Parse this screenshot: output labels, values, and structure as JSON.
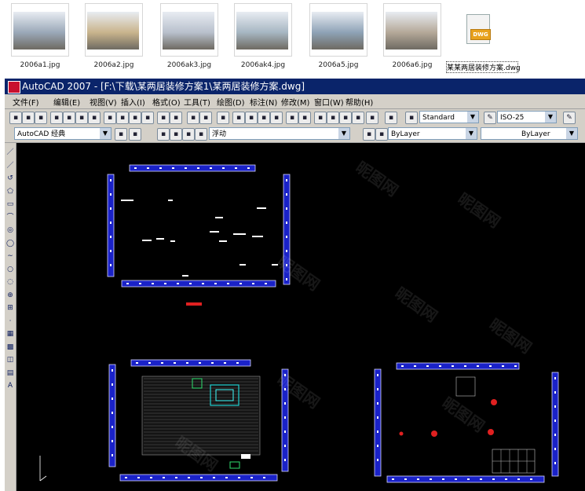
{
  "files": [
    {
      "name": "2006a1.jpg",
      "kind": "image",
      "tone": "#9aa8b8"
    },
    {
      "name": "2006a2.jpg",
      "kind": "image",
      "tone": "#c9b48c"
    },
    {
      "name": "2006ak3.jpg",
      "kind": "image",
      "tone": "#b8c0cc"
    },
    {
      "name": "2006ak4.jpg",
      "kind": "image",
      "tone": "#a6b6c2"
    },
    {
      "name": "2006a5.jpg",
      "kind": "image",
      "tone": "#8ea2b6"
    },
    {
      "name": "2006a6.jpg",
      "kind": "image",
      "tone": "#b4a898"
    },
    {
      "name": "某某两居装修方案.dwg",
      "kind": "dwg",
      "badge": "DWG",
      "selected": true
    }
  ],
  "window": {
    "title": "AutoCAD 2007 - [F:\\下载\\某两居装修方案1\\某两居装修方案.dwg]"
  },
  "menu": [
    "文件(F)",
    "编辑(E)",
    "视图(V)",
    "插入(I)",
    "格式(O)",
    "工具(T)",
    "绘图(D)",
    "标注(N)",
    "修改(M)",
    "窗口(W)",
    "帮助(H)"
  ],
  "toolbar": {
    "text_style": "Standard",
    "dim_style": "ISO-25",
    "workspace": "AutoCAD 经典",
    "layer": "浮动",
    "color": "ByLayer",
    "linetype": "ByLayer"
  },
  "canvas": {
    "background": "#000000",
    "wall_color": "#1a22c8",
    "watermark": "昵图网"
  },
  "colors": {
    "titlebar": "#0a246a",
    "chrome": "#d4d0c8"
  }
}
